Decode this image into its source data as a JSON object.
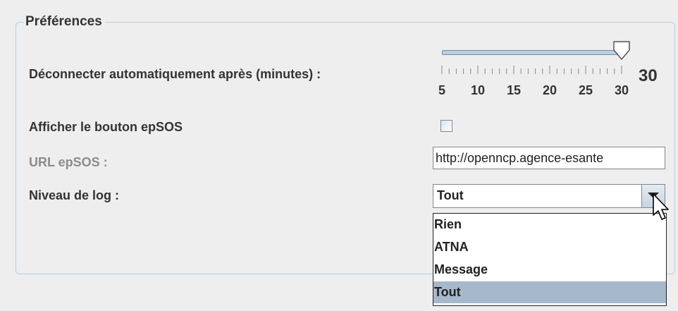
{
  "panel": {
    "title": "Préférences"
  },
  "auto_logout": {
    "label": "Déconnecter automatiquement après (minutes) :",
    "value": 30,
    "value_text": "30",
    "min": 5,
    "max": 30,
    "tick_labels": [
      "5",
      "10",
      "15",
      "20",
      "25",
      "30"
    ]
  },
  "epsos_button": {
    "label": "Afficher le bouton epSOS",
    "checked": false
  },
  "epsos_url": {
    "label": "URL epSOS :",
    "value": "http://openncp.agence-esante"
  },
  "log_level": {
    "label": "Niveau de log :",
    "selected": "Tout",
    "options": [
      "Rien",
      "ATNA",
      "Message",
      "Tout"
    ]
  },
  "colors": {
    "panel_border": "#b8cfe5",
    "selection": "#a6b8cb",
    "disabled_text": "#8c8c8c"
  }
}
